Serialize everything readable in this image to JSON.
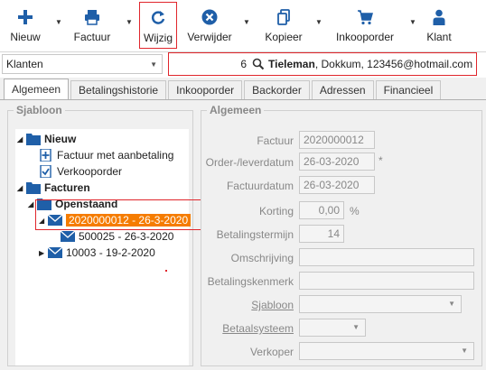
{
  "toolbar": {
    "nieuw": "Nieuw",
    "factuur": "Factuur",
    "wijzig": "Wijzig",
    "verwijder": "Verwijder",
    "kopieer": "Kopieer",
    "inkooporder": "Inkooporder",
    "klant": "Klant",
    "colors": {
      "accent": "#1f5fa8",
      "highlight": "#e0262c"
    }
  },
  "filter": {
    "type": "Klanten",
    "search_value": "6",
    "result_name": "Tieleman",
    "result_rest": ", Dokkum, 123456@hotmail.com"
  },
  "tabs": [
    "Algemeen",
    "Betalingshistorie",
    "Inkooporder",
    "Backorder",
    "Adressen",
    "Financieel"
  ],
  "left": {
    "title": "Sjabloon",
    "tree": {
      "nieuw": "Nieuw",
      "factuur_aanbetaling": "Factuur met aanbetaling",
      "verkooporder": "Verkooporder",
      "facturen": "Facturen",
      "openstaand": "Openstaand",
      "selected": "2020000012 - 26-3-2020",
      "child": "500025 - 26-3-2020",
      "other": "10003 - 19-2-2020"
    },
    "selected_color": "#f57c00"
  },
  "right": {
    "title": "Algemeen",
    "fields": {
      "factuur_label": "Factuur",
      "factuur_value": "2020000012",
      "order_label": "Order-/leverdatum",
      "order_value": "26-03-2020",
      "order_suffix": "*",
      "factuurdatum_label": "Factuurdatum",
      "factuurdatum_value": "26-03-2020",
      "korting_label": "Korting",
      "korting_value": "0,00",
      "korting_suffix": "%",
      "betalingstermijn_label": "Betalingstermijn",
      "betalingstermijn_value": "14",
      "omschrijving_label": "Omschrijving",
      "omschrijving_value": "",
      "betalingskenmerk_label": "Betalingskenmerk",
      "betalingskenmerk_value": "",
      "sjabloon_label": "Sjabloon",
      "sjabloon_value": "",
      "betaalsysteem_label": "Betaalsysteem",
      "betaalsysteem_value": "",
      "verkoper_label": "Verkoper",
      "verkoper_value": ""
    }
  }
}
